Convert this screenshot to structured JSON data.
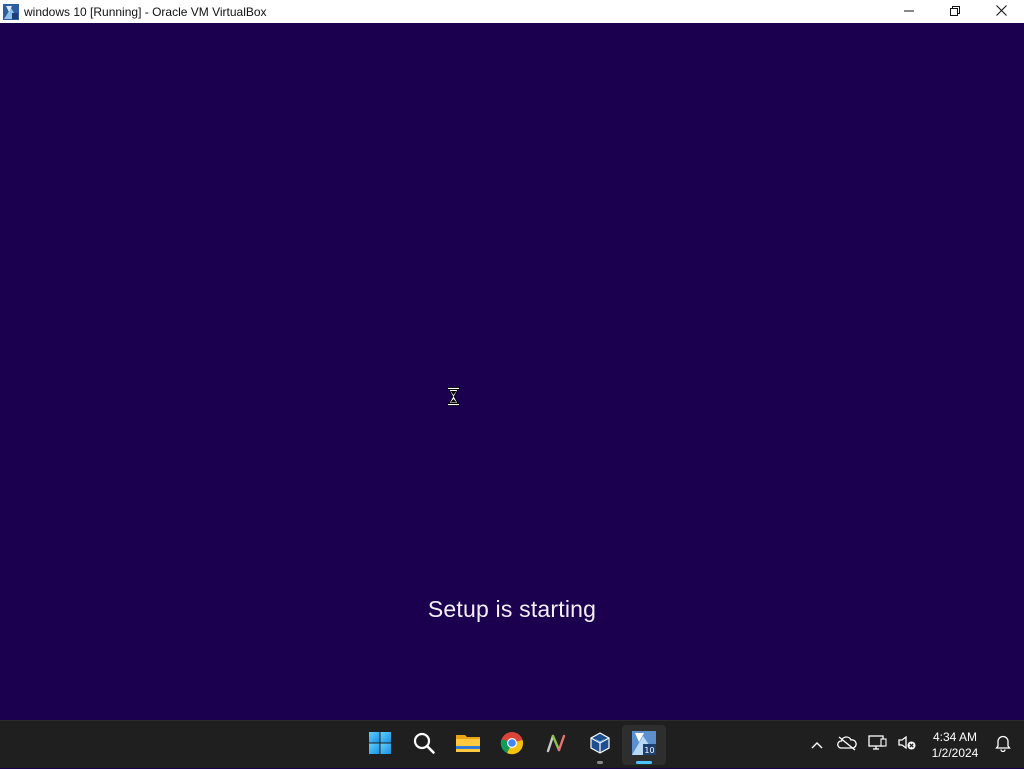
{
  "window": {
    "title": "windows 10 [Running] - Oracle VM VirtualBox",
    "icon": "virtualbox-vm-icon",
    "controls": {
      "minimize": "minimize-icon",
      "restore": "restore-icon",
      "close": "close-icon"
    }
  },
  "vm": {
    "background_color": "#1b0050",
    "status_text": "Setup is starting",
    "cursor": "hourglass-cursor-icon"
  },
  "taskbar": {
    "apps": [
      {
        "name": "start",
        "icon": "windows-start-icon",
        "running": false,
        "active": false
      },
      {
        "name": "search",
        "icon": "search-icon",
        "running": false,
        "active": false
      },
      {
        "name": "file-explorer",
        "icon": "folder-icon",
        "running": false,
        "active": false
      },
      {
        "name": "chrome",
        "icon": "chrome-icon",
        "running": false,
        "active": false
      },
      {
        "name": "app-n",
        "icon": "n-app-icon",
        "running": false,
        "active": false
      },
      {
        "name": "virtualbox",
        "icon": "virtualbox-icon",
        "running": true,
        "active": false
      },
      {
        "name": "vm-window",
        "icon": "vm-window-icon",
        "running": true,
        "active": true
      }
    ],
    "tray": {
      "chevron": "chevron-up-icon",
      "onedrive": "cloud-offline-icon",
      "network": "network-icon",
      "volume": "volume-muted-icon",
      "notifications": "bell-icon"
    },
    "clock": {
      "time": "4:34 AM",
      "date": "1/2/2024"
    }
  }
}
